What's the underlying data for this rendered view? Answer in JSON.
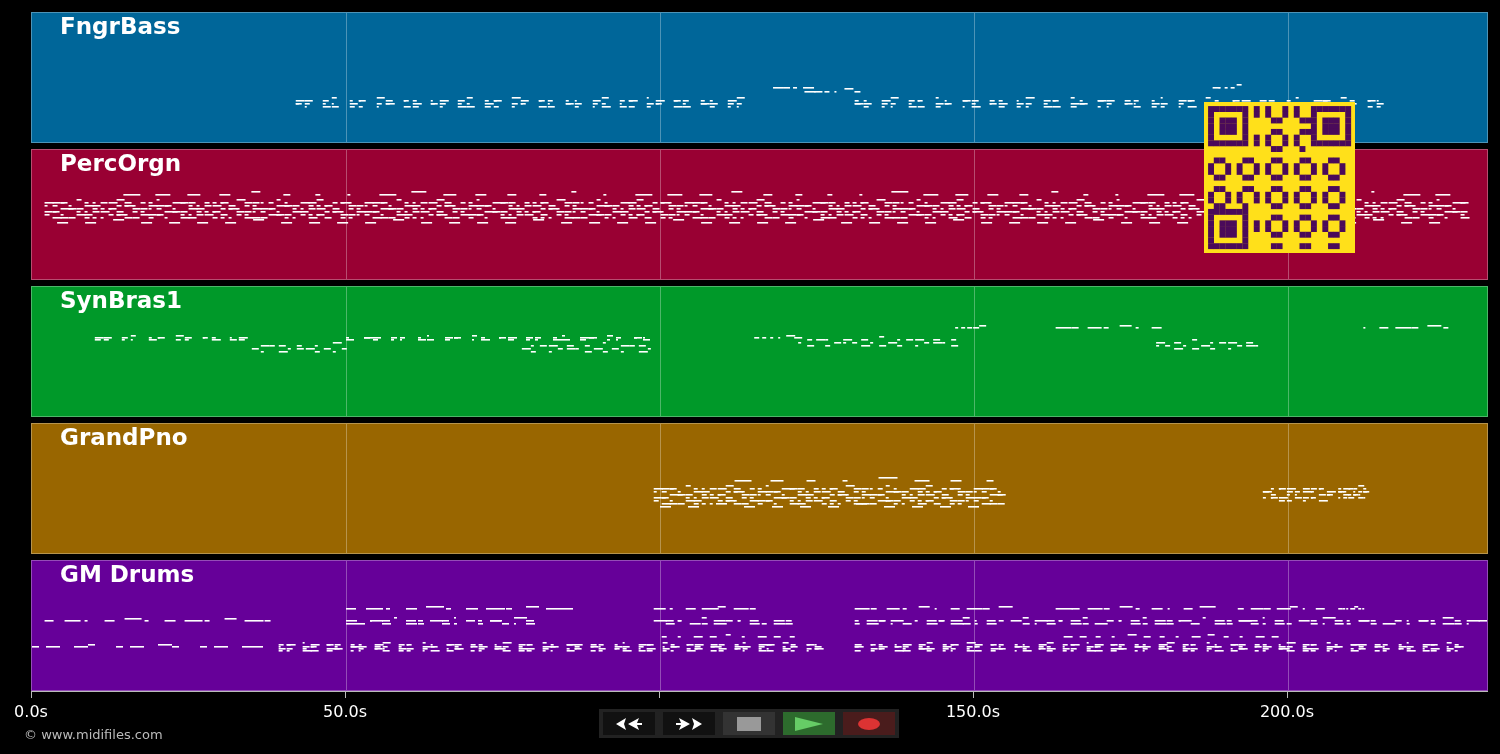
{
  "tracks": [
    {
      "name": "FngrBass",
      "color": "#006699"
    },
    {
      "name": "PercOrgn",
      "color": "#990033"
    },
    {
      "name": "SynBras1",
      "color": "#009929"
    },
    {
      "name": "GrandPno",
      "color": "#996600"
    },
    {
      "name": "GM Drums",
      "color": "#660099"
    }
  ],
  "time_axis": {
    "ticks": [
      "0.0s",
      "50.0s",
      "150.0s",
      "200.0s"
    ]
  },
  "transport": [
    {
      "kind": "rewind"
    },
    {
      "kind": "forward"
    },
    {
      "kind": "stop"
    },
    {
      "kind": "play"
    },
    {
      "kind": "record"
    }
  ],
  "copyright": "© www.midifiles.com"
}
